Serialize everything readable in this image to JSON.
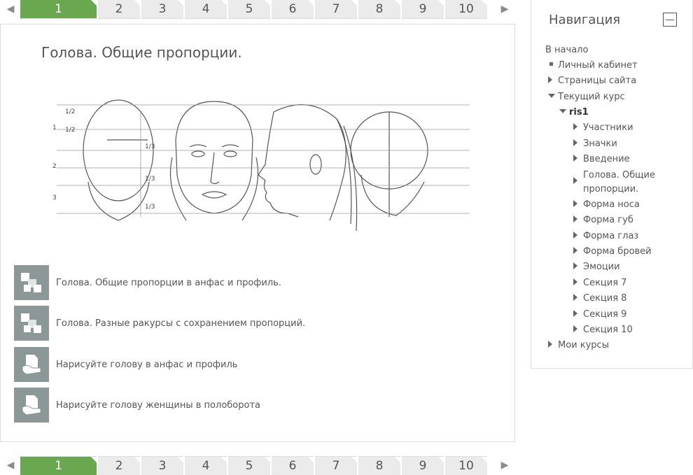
{
  "tabs": [
    "1",
    "2",
    "3",
    "4",
    "5",
    "6",
    "7",
    "8",
    "9",
    "10"
  ],
  "active_tab": "1",
  "page_title": "Голова. Общие пропорции.",
  "activities": [
    {
      "label": "Голова. Общие пропорции в анфас и профиль.",
      "icon": "page-icon"
    },
    {
      "label": "Голова. Разные ракурсы с сохранением пропорций.",
      "icon": "page-icon"
    },
    {
      "label": "Нарисуйте голову в анфас и профиль",
      "icon": "assignment-icon"
    },
    {
      "label": "Нарисуйте голову женщины в полоборота",
      "icon": "assignment-icon"
    }
  ],
  "navigation": {
    "title": "Навигация",
    "home": "В начало",
    "items": [
      {
        "label": "Личный кабинет",
        "marker": "square"
      },
      {
        "label": "Страницы сайта",
        "marker": "collapsed"
      },
      {
        "label": "Текущий курс",
        "marker": "expanded"
      },
      {
        "label": "ris1",
        "marker": "expanded"
      },
      {
        "label": "Участники",
        "marker": "collapsed"
      },
      {
        "label": "Значки",
        "marker": "collapsed"
      },
      {
        "label": "Введение",
        "marker": "collapsed"
      },
      {
        "label": "Голова. Общие пропорции.",
        "marker": "collapsed"
      },
      {
        "label": "Форма носа",
        "marker": "collapsed"
      },
      {
        "label": "Форма губ",
        "marker": "collapsed"
      },
      {
        "label": "Форма глаз",
        "marker": "collapsed"
      },
      {
        "label": "Форма бровей",
        "marker": "collapsed"
      },
      {
        "label": "Эмоции",
        "marker": "collapsed"
      },
      {
        "label": "Секция 7",
        "marker": "collapsed"
      },
      {
        "label": "Секция 8",
        "marker": "collapsed"
      },
      {
        "label": "Секция 9",
        "marker": "collapsed"
      },
      {
        "label": "Секция 10",
        "marker": "collapsed"
      },
      {
        "label": "Мои курсы",
        "marker": "collapsed"
      }
    ]
  },
  "colors": {
    "active_tab": "#6aa84f",
    "tab": "#ebebeb",
    "icon_bg": "#8c9898"
  },
  "sketch_labels": [
    "1/2",
    "1/2",
    "1",
    "2",
    "3",
    "1/3",
    "1/3",
    "1/3"
  ]
}
